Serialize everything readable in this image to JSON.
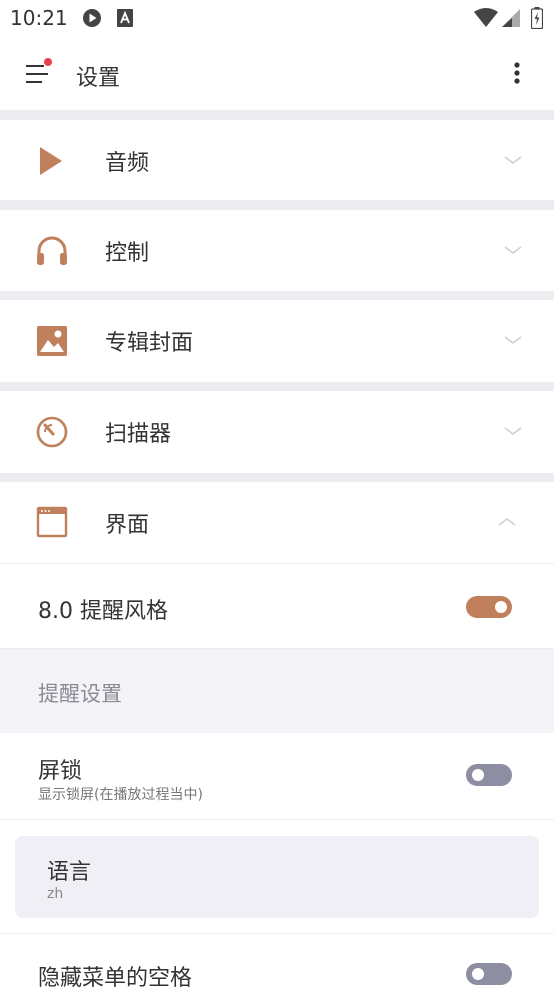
{
  "status_bar": {
    "time": "10:21",
    "icons": [
      "play-circle-icon",
      "a-square-icon",
      "wifi-icon",
      "signal-icon",
      "battery-charging-icon"
    ]
  },
  "app_bar": {
    "title": "设置",
    "menu_icon": "menu-icon",
    "more_icon": "more-vertical-icon"
  },
  "sections": [
    {
      "label": "音频",
      "icon": "play-icon",
      "expanded": false
    },
    {
      "label": "控制",
      "icon": "headphones-icon",
      "expanded": false
    },
    {
      "label": "专辑封面",
      "icon": "image-icon",
      "expanded": false
    },
    {
      "label": "扫描器",
      "icon": "gauge-icon",
      "expanded": false
    },
    {
      "label": "界面",
      "icon": "window-icon",
      "expanded": true
    }
  ],
  "interface_settings": {
    "style_toggle": {
      "title": "8.0 提醒风格",
      "on": true
    },
    "notification_header": "提醒设置",
    "lock_screen": {
      "title": "屏锁",
      "subtitle": "显示锁屏(在播放过程当中)",
      "on": false
    },
    "language": {
      "title": "语言",
      "value": "zh"
    },
    "hide_menu_spacing": {
      "title": "隐藏菜单的空格",
      "on": false
    }
  },
  "colors": {
    "accent": "#c0805c",
    "toggle_off": "#8e8ea2",
    "separator": "#ececf1",
    "header_bg": "#f4f4f8",
    "notification_dot": "#e8404c"
  }
}
